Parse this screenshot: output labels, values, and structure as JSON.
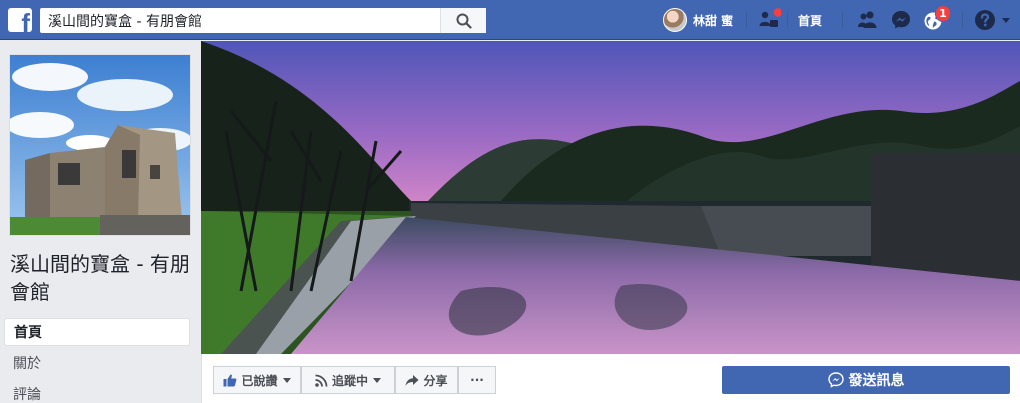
{
  "search": {
    "value": "溪山間的寶盒 - 有朋會館"
  },
  "nav": {
    "user_name": "林甜 蜜",
    "home_label": "首頁",
    "notifications_count": "1"
  },
  "page": {
    "name": "溪山間的寶盒 - 有朋會館"
  },
  "sidebar": {
    "items": [
      {
        "label": "首頁"
      },
      {
        "label": "關於"
      },
      {
        "label": "評論"
      }
    ]
  },
  "actions": {
    "like_label": "已說讚",
    "follow_label": "追蹤中",
    "share_label": "分享",
    "more_label": "···",
    "message_label": "發送訊息"
  },
  "colors": {
    "brand": "#4267b2",
    "badge": "#fa3e3e"
  }
}
